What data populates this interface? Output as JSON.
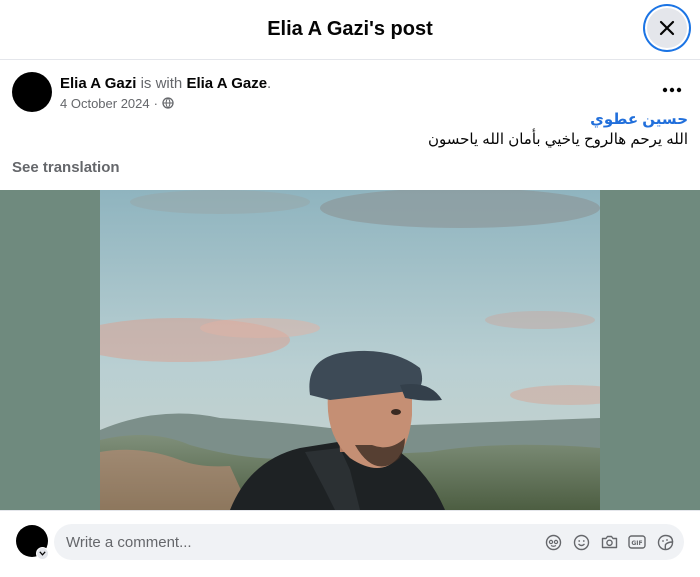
{
  "header": {
    "title": "Elia A Gazi's post"
  },
  "post": {
    "author": "Elia A Gazi",
    "with_text": "is with",
    "tagged": "Elia A Gaze",
    "period": ".",
    "date": "4 October 2024",
    "date_sep": "·",
    "privacy_icon": "globe-icon",
    "mention": "حسين عطوي",
    "message": "الله يرحم هالروح ياخيي بأمان الله ياحسون",
    "see_translation": "See translation"
  },
  "media": {
    "description_icon": "photo"
  },
  "comment": {
    "placeholder": "Write a comment...",
    "tools": [
      "avatar-sticker-icon",
      "emoji-icon",
      "camera-icon",
      "gif-icon",
      "sticker-icon"
    ]
  }
}
